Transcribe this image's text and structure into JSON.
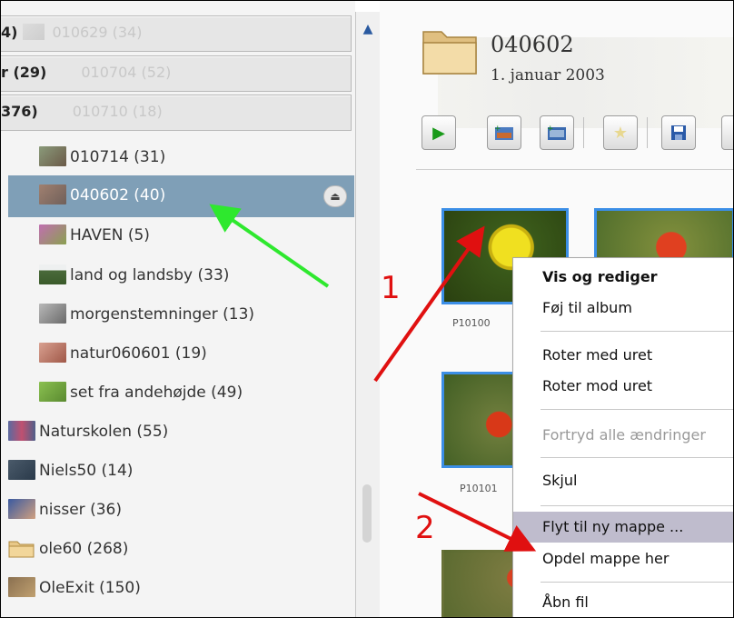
{
  "sidebar": {
    "header_rows": [
      {
        "bold": "4)",
        "gray": "010629 (34)"
      },
      {
        "bold": "r (29)",
        "gray": "010704 (52)"
      },
      {
        "bold": "376)",
        "gray": "010710 (18)"
      }
    ],
    "items": [
      {
        "label": "010714 (31)",
        "icon": "photo-thumbnail-icon"
      },
      {
        "label": "040602 (40)",
        "icon": "photo-thumbnail-icon",
        "selected": true
      },
      {
        "label": "HAVEN (5)",
        "icon": "photo-thumbnail-icon"
      },
      {
        "label": "land og landsby (33)",
        "icon": "photo-thumbnail-icon"
      },
      {
        "label": "morgenstemninger (13)",
        "icon": "photo-thumbnail-icon"
      },
      {
        "label": "natur060601 (19)",
        "icon": "photo-thumbnail-icon"
      },
      {
        "label": "set fra andehøjde (49)",
        "icon": "photo-thumbnail-icon"
      },
      {
        "label": "Naturskolen (55)",
        "icon": "photo-thumbnail-icon"
      },
      {
        "label": "Niels50 (14)",
        "icon": "photo-thumbnail-icon"
      },
      {
        "label": "nisser (36)",
        "icon": "photo-thumbnail-icon"
      },
      {
        "label": "ole60 (268)",
        "icon": "folder-icon"
      },
      {
        "label": "OleExit (150)",
        "icon": "photo-thumbnail-icon"
      }
    ],
    "eject_glyph": "⏏"
  },
  "folder": {
    "title": "040602",
    "date": "1. januar 2003"
  },
  "toolbar": {
    "buttons": [
      "play-icon",
      "add-photo-icon",
      "add-video-icon",
      "star-icon",
      "save-icon"
    ]
  },
  "photos": {
    "captions": [
      "P10100",
      "P10101"
    ]
  },
  "context_menu": {
    "items": [
      {
        "label": "Vis og rediger",
        "style": "bold"
      },
      {
        "label": "Føj til album"
      },
      {
        "label": "Roter med uret"
      },
      {
        "label": "Roter mod uret"
      },
      {
        "label": "Fortryd alle ændringer",
        "style": "disabled"
      },
      {
        "label": "Skjul"
      },
      {
        "label": "Flyt til ny mappe ...",
        "style": "highlighted"
      },
      {
        "label": "Opdel mappe her"
      },
      {
        "label": "Åbn fil"
      }
    ]
  },
  "annotations": {
    "label_1": "1",
    "label_2": "2",
    "arrow_colors": {
      "green": "#2ee82e",
      "red": "#e01010"
    }
  },
  "colors": {
    "selection": "#7f9fb7",
    "photo_border": "#3b8ee6",
    "menu_highlight": "#bfbccd"
  }
}
